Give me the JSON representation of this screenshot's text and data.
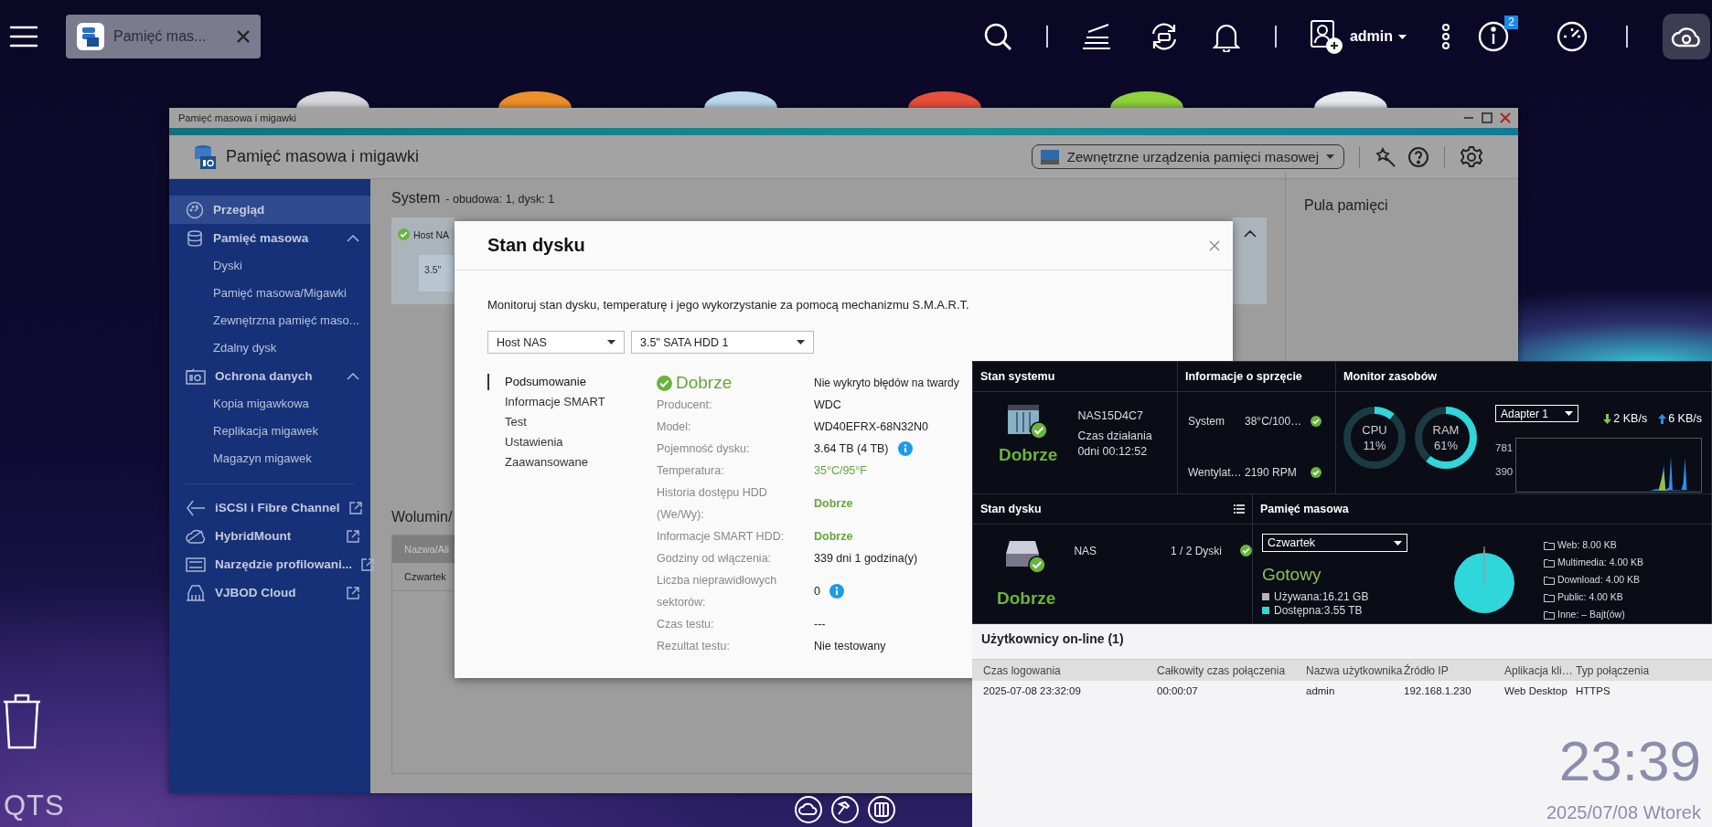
{
  "taskbar": {
    "app_tab": {
      "label": "Pamięć mas..."
    },
    "user": {
      "name": "admin"
    },
    "notification_badge": "2"
  },
  "window": {
    "title": "Pamięć masowa i migawki",
    "app_title": "Pamięć masowa i migawki",
    "external_devices_dropdown": "Zewnętrzne urządzenia pamięci masowej",
    "sidebar": {
      "items": [
        {
          "label": "Przegląd",
          "kind": "page",
          "selected": true
        },
        {
          "label": "Pamięć masowa",
          "kind": "group",
          "selected": false,
          "expanded": true,
          "children": [
            {
              "label": "Dyski",
              "selected": false
            },
            {
              "label": "Pamięć masowa/Migawki",
              "selected": false
            },
            {
              "label": "Zewnętrzna pamięć maso...",
              "selected": false
            },
            {
              "label": "Zdalny dysk",
              "selected": false
            }
          ]
        },
        {
          "label": "Ochrona danych",
          "kind": "group",
          "selected": false,
          "expanded": true,
          "children": [
            {
              "label": "Kopia migawkowa",
              "selected": false
            },
            {
              "label": "Replikacja migawek",
              "selected": false
            },
            {
              "label": "Magazyn migawek",
              "selected": false
            }
          ]
        },
        {
          "label": "iSCSI i Fibre Channel",
          "kind": "link",
          "selected": false
        },
        {
          "label": "HybridMount",
          "kind": "link",
          "selected": false
        },
        {
          "label": "Narzędzie profilowani...",
          "kind": "link",
          "selected": false
        },
        {
          "label": "VJBOD Cloud",
          "kind": "link",
          "selected": false
        }
      ]
    },
    "system_section": {
      "title": "System",
      "subtitle": "- obudowa: 1, dysk: 1",
      "enclosure": "Host NA",
      "disk_slot": "3.5\""
    },
    "volume_section": {
      "title": "Wolumin/",
      "column": "Nazwa/Ali",
      "row": "Czwartek"
    },
    "pool_section": {
      "title": "Pula pamięci"
    }
  },
  "dialog": {
    "title": "Stan dysku",
    "description": "Monitoruj stan dysku, temperaturę i jego wykorzystanie za pomocą mechanizmu S.M.A.R.T.",
    "selects": [
      {
        "value": "Host NAS"
      },
      {
        "value": "3.5\" SATA HDD 1"
      }
    ],
    "nav": [
      {
        "label": "Podsumowanie",
        "selected": true
      },
      {
        "label": "Informacje SMART",
        "selected": false
      },
      {
        "label": "Test",
        "selected": false
      },
      {
        "label": "Ustawienia",
        "selected": false
      },
      {
        "label": "Zaawansowane",
        "selected": false
      }
    ],
    "status": "Dobrze",
    "status_note": "Nie wykryto błędów na twardy",
    "details": [
      {
        "label": "Producent:",
        "value": "WDC",
        "kind": "plain",
        "info": false
      },
      {
        "label": "Model:",
        "value": "WD40EFRX-68N32N0",
        "kind": "plain",
        "info": false
      },
      {
        "label": "Pojemność dysku:",
        "value": "3.64 TB (4 TB)",
        "kind": "plain",
        "info": true
      },
      {
        "label": "Temperatura:",
        "value": "35°C/95°F",
        "kind": "good",
        "info": false
      },
      {
        "label": "Historia dostępu HDD (We/Wy):",
        "value": "Dobrze",
        "kind": "strong",
        "info": false
      },
      {
        "label": "Informacje SMART HDD:",
        "value": "Dobrze",
        "kind": "strong",
        "info": false
      },
      {
        "label": "Godziny od włączenia:",
        "value": "339 dni 1 godzina(y)",
        "kind": "plain",
        "info": false
      },
      {
        "label": "Liczba nieprawidłowych sektorów:",
        "value": "0",
        "kind": "plain",
        "info": true
      },
      {
        "label": "Czas testu:",
        "value": "---",
        "kind": "plain",
        "info": false
      },
      {
        "label": "Rezultat testu:",
        "value": "Nie testowany",
        "kind": "plain",
        "info": false
      }
    ]
  },
  "dashboard": {
    "system_status": {
      "title": "Stan systemu",
      "hostname": "NAS15D4C7",
      "uptime_label": "Czas działania",
      "uptime": "0dni 00:12:52",
      "status": "Dobrze"
    },
    "hardware": {
      "title": "Informacje o sprzęcie",
      "rows": [
        {
          "label": "System",
          "value": "38°C/100…"
        },
        {
          "label": "Wentylat…",
          "value": "2190 RPM"
        }
      ]
    },
    "resource_monitor": {
      "title": "Monitor zasobów",
      "gauges": [
        {
          "label": "CPU",
          "reading": "11%",
          "level": 0.11
        },
        {
          "label": "RAM",
          "reading": "61%",
          "level": 0.61
        }
      ],
      "adapter": "Adapter 1",
      "download": "2 KB/s",
      "upload": "6 KB/s",
      "axis_labels": [
        "781",
        "390"
      ]
    },
    "disk_status": {
      "title": "Stan dysku",
      "device": "NAS",
      "disks": "1 / 2 Dyski",
      "status": "Dobrze"
    },
    "storage": {
      "title": "Pamięć masowa",
      "volume": "Czwartek",
      "state": "Gotowy",
      "legend": [
        {
          "label": "Używana:16.21 GB",
          "color": "#b4b4b4"
        },
        {
          "label": "Dostępna:3.55 TB",
          "color": "#2fd6da"
        }
      ],
      "folders": [
        {
          "name": "Web:",
          "size": "8.00 KB"
        },
        {
          "name": "Multimedia:",
          "size": "4.00 KB"
        },
        {
          "name": "Download:",
          "size": "4.00 KB"
        },
        {
          "name": "Public:",
          "size": "4.00 KB"
        },
        {
          "name": "Inne:",
          "size": "– Bajt(ów)"
        }
      ]
    },
    "online_users": {
      "title": "Użytkownicy on-line (1)",
      "columns": [
        "Czas logowania",
        "Całkowity czas połączenia",
        "Nazwa użytkownika",
        "Źródło IP",
        "Aplikacja kli…",
        "Typ połączenia"
      ],
      "rows": [
        [
          "2025-07-08 23:32:09",
          "00:00:07",
          "admin",
          "192.168.1.230",
          "Web Desktop",
          "HTTPS"
        ]
      ]
    }
  },
  "desktop": {
    "clock": {
      "time": "23:39",
      "date": "2025/07/08 Wtorek"
    },
    "logo": "QTS"
  }
}
